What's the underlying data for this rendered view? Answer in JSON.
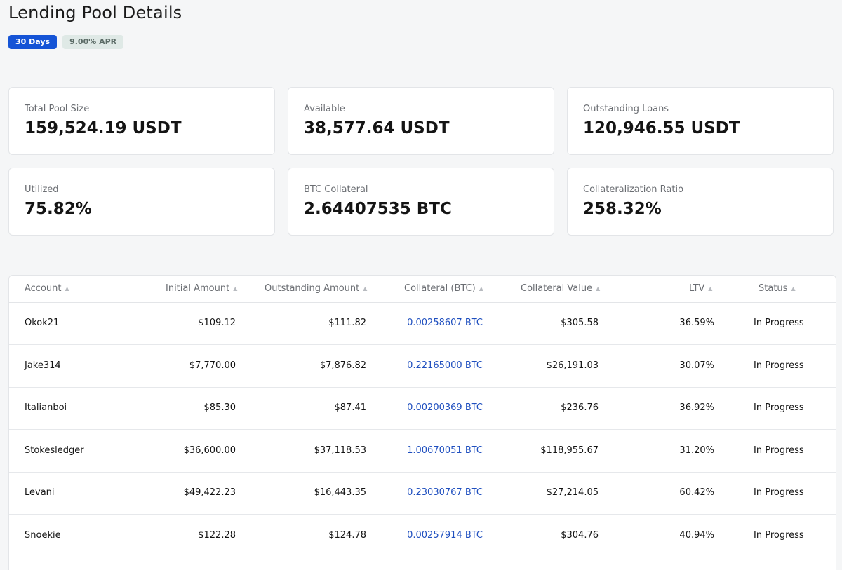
{
  "page": {
    "title": "Lending Pool Details",
    "badges": {
      "period": "30 Days",
      "apr": "9.00% APR"
    }
  },
  "stats": [
    {
      "label": "Total Pool Size",
      "value": "159,524.19 USDT"
    },
    {
      "label": "Available",
      "value": "38,577.64 USDT"
    },
    {
      "label": "Outstanding Loans",
      "value": "120,946.55 USDT"
    },
    {
      "label": "Utilized",
      "value": "75.82%"
    },
    {
      "label": "BTC Collateral",
      "value": "2.64407535 BTC"
    },
    {
      "label": "Collateralization Ratio",
      "value": "258.32%"
    }
  ],
  "table": {
    "sort_icon": "sort-icon",
    "sort_glyph": "▲",
    "columns": [
      "Account",
      "Initial Amount",
      "Outstanding Amount",
      "Collateral (BTC)",
      "Collateral Value",
      "LTV",
      "Status"
    ],
    "rows": [
      {
        "account": "Okok21",
        "initial": "$109.12",
        "outstanding": "$111.82",
        "collateral_btc": "0.00258607 BTC",
        "collateral_value": "$305.58",
        "ltv": "36.59%",
        "status": "In Progress"
      },
      {
        "account": "Jake314",
        "initial": "$7,770.00",
        "outstanding": "$7,876.82",
        "collateral_btc": "0.22165000 BTC",
        "collateral_value": "$26,191.03",
        "ltv": "30.07%",
        "status": "In Progress"
      },
      {
        "account": "Italianboi",
        "initial": "$85.30",
        "outstanding": "$87.41",
        "collateral_btc": "0.00200369 BTC",
        "collateral_value": "$236.76",
        "ltv": "36.92%",
        "status": "In Progress"
      },
      {
        "account": "Stokesledger",
        "initial": "$36,600.00",
        "outstanding": "$37,118.53",
        "collateral_btc": "1.00670051 BTC",
        "collateral_value": "$118,955.67",
        "ltv": "31.20%",
        "status": "In Progress"
      },
      {
        "account": "Levani",
        "initial": "$49,422.23",
        "outstanding": "$16,443.35",
        "collateral_btc": "0.23030767 BTC",
        "collateral_value": "$27,214.05",
        "ltv": "60.42%",
        "status": "In Progress"
      },
      {
        "account": "Snoekie",
        "initial": "$122.28",
        "outstanding": "$124.78",
        "collateral_btc": "0.00257914 BTC",
        "collateral_value": "$304.76",
        "ltv": "40.94%",
        "status": "In Progress"
      }
    ]
  },
  "colors": {
    "accent": "#1554d6",
    "link": "#1f4fbf",
    "apr_badge_bg": "#dfe9e6"
  }
}
